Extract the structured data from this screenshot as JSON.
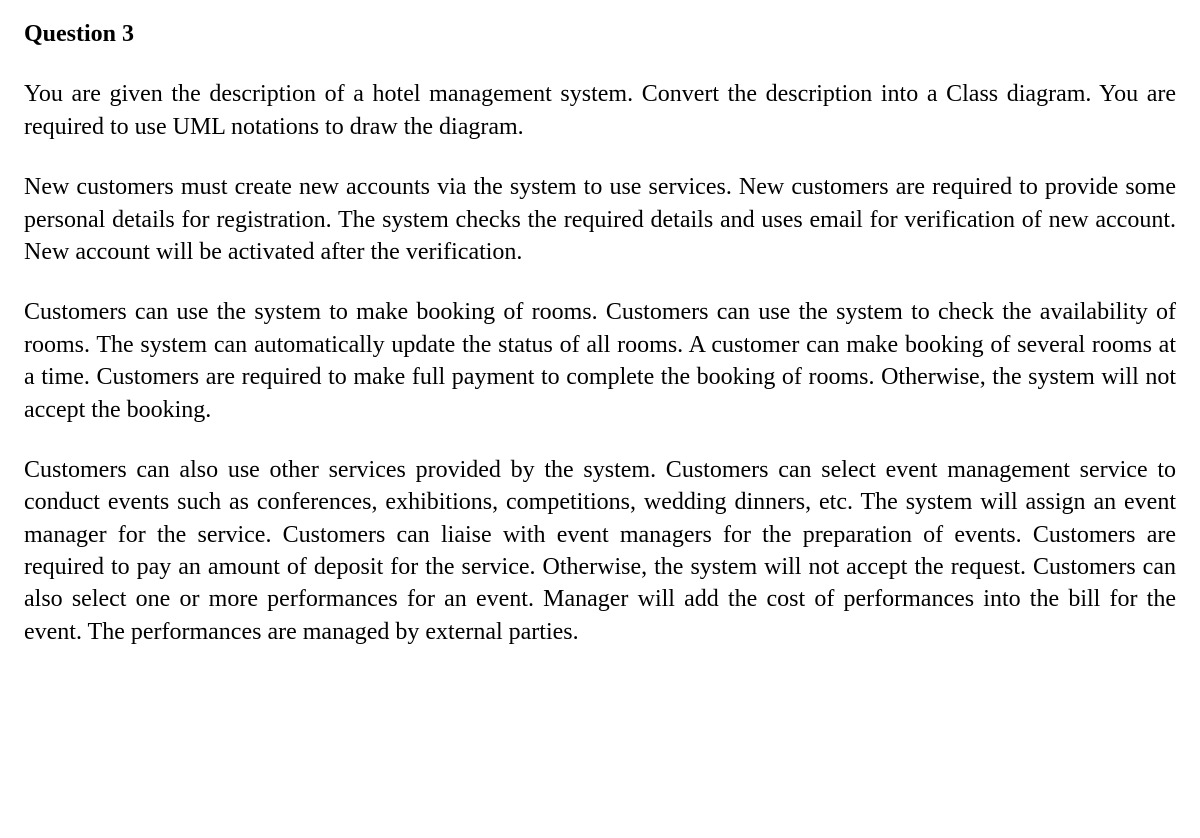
{
  "heading": "Question 3",
  "paragraphs": [
    "You are given the description of a hotel management system. Convert the description into a Class diagram. You are required to use UML notations to draw the diagram.",
    "New customers must create new accounts via the system to use services. New customers are required to provide some personal details for registration. The system checks the required details and uses email for verification of new account. New account will be activated after the verification.",
    "Customers can use the system to make booking of rooms. Customers can use the system to check the availability of rooms. The system can automatically update the status of all rooms. A customer can make booking of several rooms at a time. Customers are required to make full payment to complete the booking of rooms. Otherwise, the system will not accept the booking.",
    "Customers can also use other services provided by the system. Customers can select event management service to conduct events such as conferences, exhibitions, competitions, wedding dinners, etc. The system will assign an event manager for the service. Customers can liaise with event managers for the preparation of events. Customers are required to pay an amount of deposit for the service. Otherwise, the system will not accept the request. Customers can also select one or more performances for an event. Manager will add the cost of performances into the bill for the event. The performances are managed by external parties."
  ]
}
